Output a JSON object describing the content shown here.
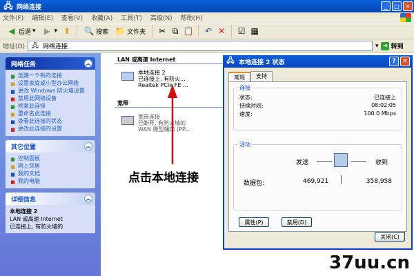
{
  "window": {
    "title": "网络连接"
  },
  "menu": [
    "文件(F)",
    "编辑(E)",
    "查看(V)",
    "收藏(A)",
    "工具(T)",
    "高级(N)",
    "帮助(H)"
  ],
  "toolbar": {
    "back": "后退",
    "search": "搜索",
    "folders": "文件夹"
  },
  "address": {
    "label": "地址(D)",
    "value": "网络连接",
    "go": "转到"
  },
  "tasks_panel": {
    "title": "网络任务",
    "items": [
      "创建一个新的连接",
      "设置家庭或小型办公网络",
      "更改 Windows 防火墙设置",
      "禁用此网络设备",
      "修复此连接",
      "重命名此连接",
      "查看此连接的状态",
      "更改此连接的设置"
    ]
  },
  "other_places": {
    "title": "其它位置",
    "items": [
      "控制面板",
      "网上邻居",
      "我的文档",
      "我的电脑"
    ]
  },
  "details": {
    "title": "详细信息",
    "name": "本地连接 2",
    "line1": "LAN 或高速 Internet",
    "line2": "已连接上, 有防火墙的"
  },
  "groups": {
    "lan": "LAN 或高速 Internet",
    "broadband": "宽带"
  },
  "connections": {
    "local": {
      "name": "本地连接 2",
      "status": "已连接上, 有防火...",
      "device": "Realtek PCIe FE ..."
    },
    "broadband": {
      "name": "宽带连接",
      "status": "已断开, 有防火墙的",
      "device": "WAN 微型端口 (PP..."
    }
  },
  "annotation": "点击本地连接",
  "dialog": {
    "title": "本地连接 2 状态",
    "tabs": [
      "常规",
      "支持"
    ],
    "connection_legend": "连接",
    "status_label": "状态:",
    "status_value": "已连接上",
    "duration_label": "持续时间:",
    "duration_value": "08:02:05",
    "speed_label": "速度:",
    "speed_value": "100.0 Mbps",
    "activity_legend": "活动",
    "sent_label": "发送",
    "received_label": "收到",
    "packets_label": "数据包:",
    "packets_sent": "469,921",
    "packets_received": "358,958",
    "properties_btn": "属性(P)",
    "disable_btn": "禁用(D)",
    "close_btn": "关闭(C)"
  },
  "watermark": "37uu.cn",
  "colors": {
    "title_blue": "#0a5fd8",
    "task_pane": "#6f8fe0",
    "link": "#215dc6"
  }
}
